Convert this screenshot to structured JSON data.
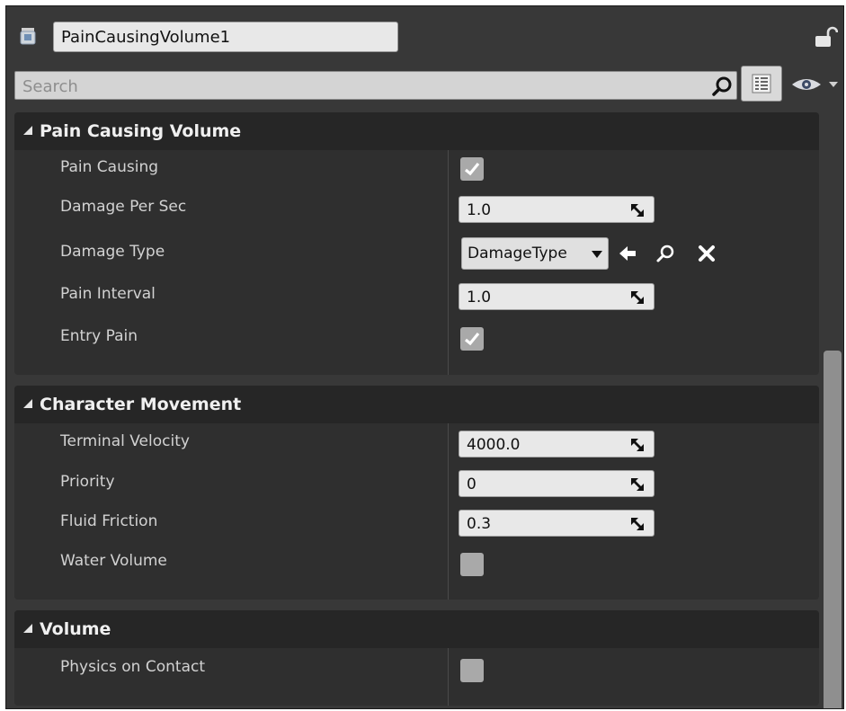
{
  "header": {
    "actor_name": "PainCausingVolume1",
    "actor_icon": "pain-causing-volume-icon",
    "lock_icon": "lock-icon"
  },
  "search": {
    "placeholder": "Search",
    "value": "",
    "search_icon": "search-icon",
    "grid_icon": "grid-view-icon",
    "eye_icon": "eye-icon"
  },
  "sections": [
    {
      "title": "Pain Causing Volume",
      "properties": [
        {
          "label": "Pain Causing",
          "type": "checkbox",
          "checked": true
        },
        {
          "label": "Damage Per Sec",
          "type": "number",
          "value": "1.0"
        },
        {
          "label": "Damage Type",
          "type": "class-picker",
          "value": "DamageType"
        },
        {
          "label": "Pain Interval",
          "type": "number",
          "value": "1.0"
        },
        {
          "label": "Entry Pain",
          "type": "checkbox",
          "checked": true
        }
      ]
    },
    {
      "title": "Character Movement",
      "properties": [
        {
          "label": "Terminal Velocity",
          "type": "number",
          "value": "4000.0"
        },
        {
          "label": "Priority",
          "type": "number",
          "value": "0"
        },
        {
          "label": "Fluid Friction",
          "type": "number",
          "value": "0.3"
        },
        {
          "label": "Water Volume",
          "type": "checkbox",
          "checked": false
        }
      ]
    },
    {
      "title": "Volume",
      "properties": [
        {
          "label": "Physics on Contact",
          "type": "checkbox",
          "checked": false
        }
      ]
    }
  ],
  "colors": {
    "panel_bg": "#383838",
    "section_bg": "#2f2f2f",
    "header_bg": "#262626",
    "field_bg": "#e8e8e8"
  }
}
